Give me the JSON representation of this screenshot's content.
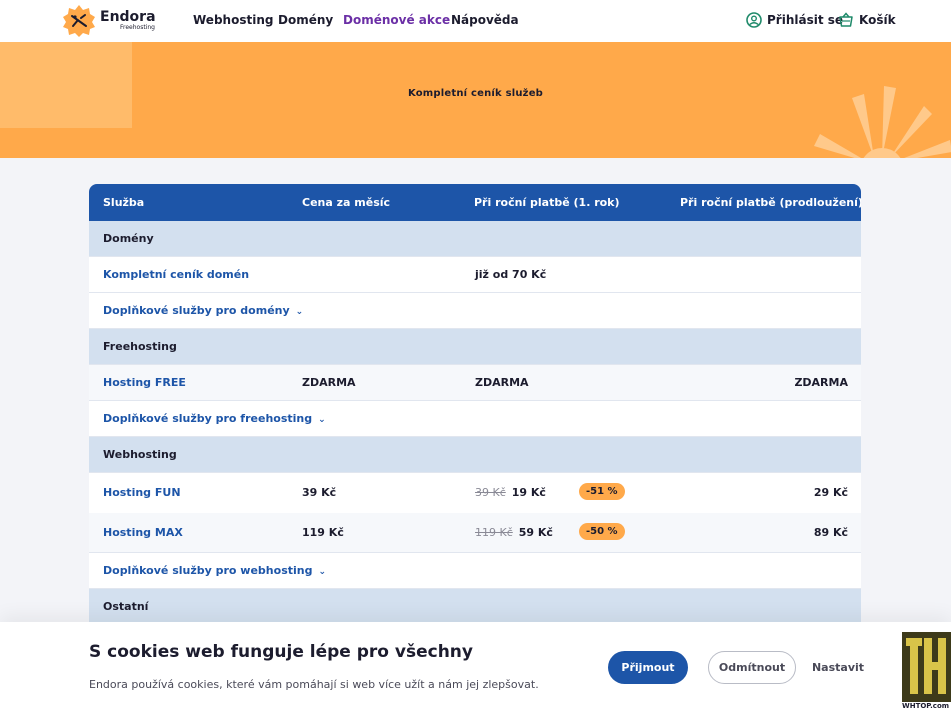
{
  "header": {
    "logo_text": "Endora",
    "logo_sub": "Freehosting",
    "nav": [
      "Webhosting",
      "Domény",
      "Doménové akce",
      "Nápověda"
    ],
    "login": "Přihlásit se",
    "cart": "Košík"
  },
  "hero": {
    "title": "Kompletní ceník služeb"
  },
  "table": {
    "headers": [
      "Služba",
      "Cena za měsíc",
      "Při roční platbě (1. rok)",
      "Při roční platbě (prodloužení)"
    ],
    "domeny": {
      "section": "Domény",
      "pricelist_link": "Kompletní ceník domén",
      "pricelist_value": "již od 70 Kč",
      "addons": "Doplňkové služby pro domény"
    },
    "freehosting": {
      "section": "Freehosting",
      "name": "Hosting FREE",
      "monthly": "ZDARMA",
      "year1": "ZDARMA",
      "renewal": "ZDARMA",
      "addons": "Doplňkové služby pro freehosting"
    },
    "webhosting": {
      "section": "Webhosting",
      "rows": [
        {
          "name": "Hosting FUN",
          "monthly": "39 Kč",
          "old_price": "39 Kč",
          "year1": "19 Kč",
          "discount": "-51 %",
          "renewal": "29 Kč"
        },
        {
          "name": "Hosting MAX",
          "monthly": "119 Kč",
          "old_price": "119 Kč",
          "year1": "59 Kč",
          "discount": "-50 %",
          "renewal": "89 Kč"
        }
      ],
      "addons": "Doplňkové služby pro webhosting"
    },
    "ostatni": {
      "section": "Ostatní"
    }
  },
  "cookie": {
    "title": "S cookies web funguje lépe pro všechny",
    "text": "Endora používá cookies, které vám pomáhají si web více užít a nám jej zlepšovat.",
    "accept": "Přijmout",
    "reject": "Odmítnout",
    "settings": "Nastavit"
  },
  "watermark": {
    "text": "WHTOP.com"
  },
  "colors": {
    "brand_blue": "#1d55a8",
    "accent_orange": "#ffa94a",
    "section_bg": "#d3e0ef",
    "active_nav": "#6b2fa6"
  }
}
